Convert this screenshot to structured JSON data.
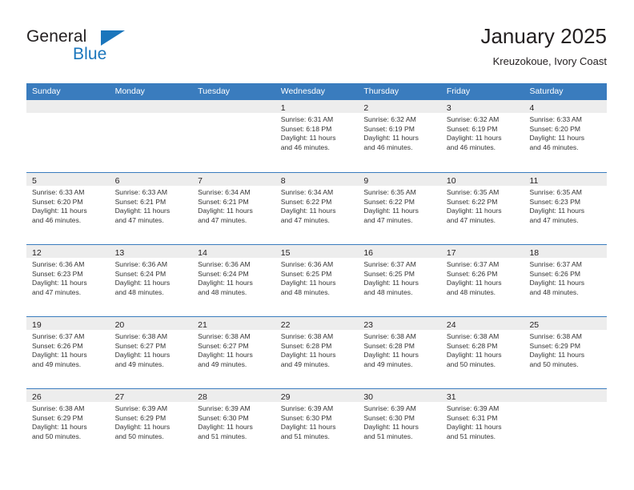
{
  "brand": {
    "name_part1": "General",
    "name_part2": "Blue",
    "triangle_icon": "triangle-icon",
    "accent_color": "#1b76bc"
  },
  "header": {
    "title": "January 2025",
    "subtitle": "Kreuzokoue, Ivory Coast"
  },
  "theme": {
    "header_bar_color": "#3a7cbe",
    "day_band_color": "#ededed",
    "text_color": "#231f20"
  },
  "weekday_headers": [
    "Sunday",
    "Monday",
    "Tuesday",
    "Wednesday",
    "Thursday",
    "Friday",
    "Saturday"
  ],
  "weeks": [
    [
      {
        "day": "",
        "sunrise": "",
        "sunset": "",
        "daylight1": "",
        "daylight2": "",
        "empty": true
      },
      {
        "day": "",
        "sunrise": "",
        "sunset": "",
        "daylight1": "",
        "daylight2": "",
        "empty": true
      },
      {
        "day": "",
        "sunrise": "",
        "sunset": "",
        "daylight1": "",
        "daylight2": "",
        "empty": true
      },
      {
        "day": "1",
        "sunrise": "Sunrise: 6:31 AM",
        "sunset": "Sunset: 6:18 PM",
        "daylight1": "Daylight: 11 hours",
        "daylight2": "and 46 minutes."
      },
      {
        "day": "2",
        "sunrise": "Sunrise: 6:32 AM",
        "sunset": "Sunset: 6:19 PM",
        "daylight1": "Daylight: 11 hours",
        "daylight2": "and 46 minutes."
      },
      {
        "day": "3",
        "sunrise": "Sunrise: 6:32 AM",
        "sunset": "Sunset: 6:19 PM",
        "daylight1": "Daylight: 11 hours",
        "daylight2": "and 46 minutes."
      },
      {
        "day": "4",
        "sunrise": "Sunrise: 6:33 AM",
        "sunset": "Sunset: 6:20 PM",
        "daylight1": "Daylight: 11 hours",
        "daylight2": "and 46 minutes."
      }
    ],
    [
      {
        "day": "5",
        "sunrise": "Sunrise: 6:33 AM",
        "sunset": "Sunset: 6:20 PM",
        "daylight1": "Daylight: 11 hours",
        "daylight2": "and 46 minutes."
      },
      {
        "day": "6",
        "sunrise": "Sunrise: 6:33 AM",
        "sunset": "Sunset: 6:21 PM",
        "daylight1": "Daylight: 11 hours",
        "daylight2": "and 47 minutes."
      },
      {
        "day": "7",
        "sunrise": "Sunrise: 6:34 AM",
        "sunset": "Sunset: 6:21 PM",
        "daylight1": "Daylight: 11 hours",
        "daylight2": "and 47 minutes."
      },
      {
        "day": "8",
        "sunrise": "Sunrise: 6:34 AM",
        "sunset": "Sunset: 6:22 PM",
        "daylight1": "Daylight: 11 hours",
        "daylight2": "and 47 minutes."
      },
      {
        "day": "9",
        "sunrise": "Sunrise: 6:35 AM",
        "sunset": "Sunset: 6:22 PM",
        "daylight1": "Daylight: 11 hours",
        "daylight2": "and 47 minutes."
      },
      {
        "day": "10",
        "sunrise": "Sunrise: 6:35 AM",
        "sunset": "Sunset: 6:22 PM",
        "daylight1": "Daylight: 11 hours",
        "daylight2": "and 47 minutes."
      },
      {
        "day": "11",
        "sunrise": "Sunrise: 6:35 AM",
        "sunset": "Sunset: 6:23 PM",
        "daylight1": "Daylight: 11 hours",
        "daylight2": "and 47 minutes."
      }
    ],
    [
      {
        "day": "12",
        "sunrise": "Sunrise: 6:36 AM",
        "sunset": "Sunset: 6:23 PM",
        "daylight1": "Daylight: 11 hours",
        "daylight2": "and 47 minutes."
      },
      {
        "day": "13",
        "sunrise": "Sunrise: 6:36 AM",
        "sunset": "Sunset: 6:24 PM",
        "daylight1": "Daylight: 11 hours",
        "daylight2": "and 48 minutes."
      },
      {
        "day": "14",
        "sunrise": "Sunrise: 6:36 AM",
        "sunset": "Sunset: 6:24 PM",
        "daylight1": "Daylight: 11 hours",
        "daylight2": "and 48 minutes."
      },
      {
        "day": "15",
        "sunrise": "Sunrise: 6:36 AM",
        "sunset": "Sunset: 6:25 PM",
        "daylight1": "Daylight: 11 hours",
        "daylight2": "and 48 minutes."
      },
      {
        "day": "16",
        "sunrise": "Sunrise: 6:37 AM",
        "sunset": "Sunset: 6:25 PM",
        "daylight1": "Daylight: 11 hours",
        "daylight2": "and 48 minutes."
      },
      {
        "day": "17",
        "sunrise": "Sunrise: 6:37 AM",
        "sunset": "Sunset: 6:26 PM",
        "daylight1": "Daylight: 11 hours",
        "daylight2": "and 48 minutes."
      },
      {
        "day": "18",
        "sunrise": "Sunrise: 6:37 AM",
        "sunset": "Sunset: 6:26 PM",
        "daylight1": "Daylight: 11 hours",
        "daylight2": "and 48 minutes."
      }
    ],
    [
      {
        "day": "19",
        "sunrise": "Sunrise: 6:37 AM",
        "sunset": "Sunset: 6:26 PM",
        "daylight1": "Daylight: 11 hours",
        "daylight2": "and 49 minutes."
      },
      {
        "day": "20",
        "sunrise": "Sunrise: 6:38 AM",
        "sunset": "Sunset: 6:27 PM",
        "daylight1": "Daylight: 11 hours",
        "daylight2": "and 49 minutes."
      },
      {
        "day": "21",
        "sunrise": "Sunrise: 6:38 AM",
        "sunset": "Sunset: 6:27 PM",
        "daylight1": "Daylight: 11 hours",
        "daylight2": "and 49 minutes."
      },
      {
        "day": "22",
        "sunrise": "Sunrise: 6:38 AM",
        "sunset": "Sunset: 6:28 PM",
        "daylight1": "Daylight: 11 hours",
        "daylight2": "and 49 minutes."
      },
      {
        "day": "23",
        "sunrise": "Sunrise: 6:38 AM",
        "sunset": "Sunset: 6:28 PM",
        "daylight1": "Daylight: 11 hours",
        "daylight2": "and 49 minutes."
      },
      {
        "day": "24",
        "sunrise": "Sunrise: 6:38 AM",
        "sunset": "Sunset: 6:28 PM",
        "daylight1": "Daylight: 11 hours",
        "daylight2": "and 50 minutes."
      },
      {
        "day": "25",
        "sunrise": "Sunrise: 6:38 AM",
        "sunset": "Sunset: 6:29 PM",
        "daylight1": "Daylight: 11 hours",
        "daylight2": "and 50 minutes."
      }
    ],
    [
      {
        "day": "26",
        "sunrise": "Sunrise: 6:38 AM",
        "sunset": "Sunset: 6:29 PM",
        "daylight1": "Daylight: 11 hours",
        "daylight2": "and 50 minutes."
      },
      {
        "day": "27",
        "sunrise": "Sunrise: 6:39 AM",
        "sunset": "Sunset: 6:29 PM",
        "daylight1": "Daylight: 11 hours",
        "daylight2": "and 50 minutes."
      },
      {
        "day": "28",
        "sunrise": "Sunrise: 6:39 AM",
        "sunset": "Sunset: 6:30 PM",
        "daylight1": "Daylight: 11 hours",
        "daylight2": "and 51 minutes."
      },
      {
        "day": "29",
        "sunrise": "Sunrise: 6:39 AM",
        "sunset": "Sunset: 6:30 PM",
        "daylight1": "Daylight: 11 hours",
        "daylight2": "and 51 minutes."
      },
      {
        "day": "30",
        "sunrise": "Sunrise: 6:39 AM",
        "sunset": "Sunset: 6:30 PM",
        "daylight1": "Daylight: 11 hours",
        "daylight2": "and 51 minutes."
      },
      {
        "day": "31",
        "sunrise": "Sunrise: 6:39 AM",
        "sunset": "Sunset: 6:31 PM",
        "daylight1": "Daylight: 11 hours",
        "daylight2": "and 51 minutes."
      },
      {
        "day": "",
        "sunrise": "",
        "sunset": "",
        "daylight1": "",
        "daylight2": "",
        "empty": true
      }
    ]
  ]
}
